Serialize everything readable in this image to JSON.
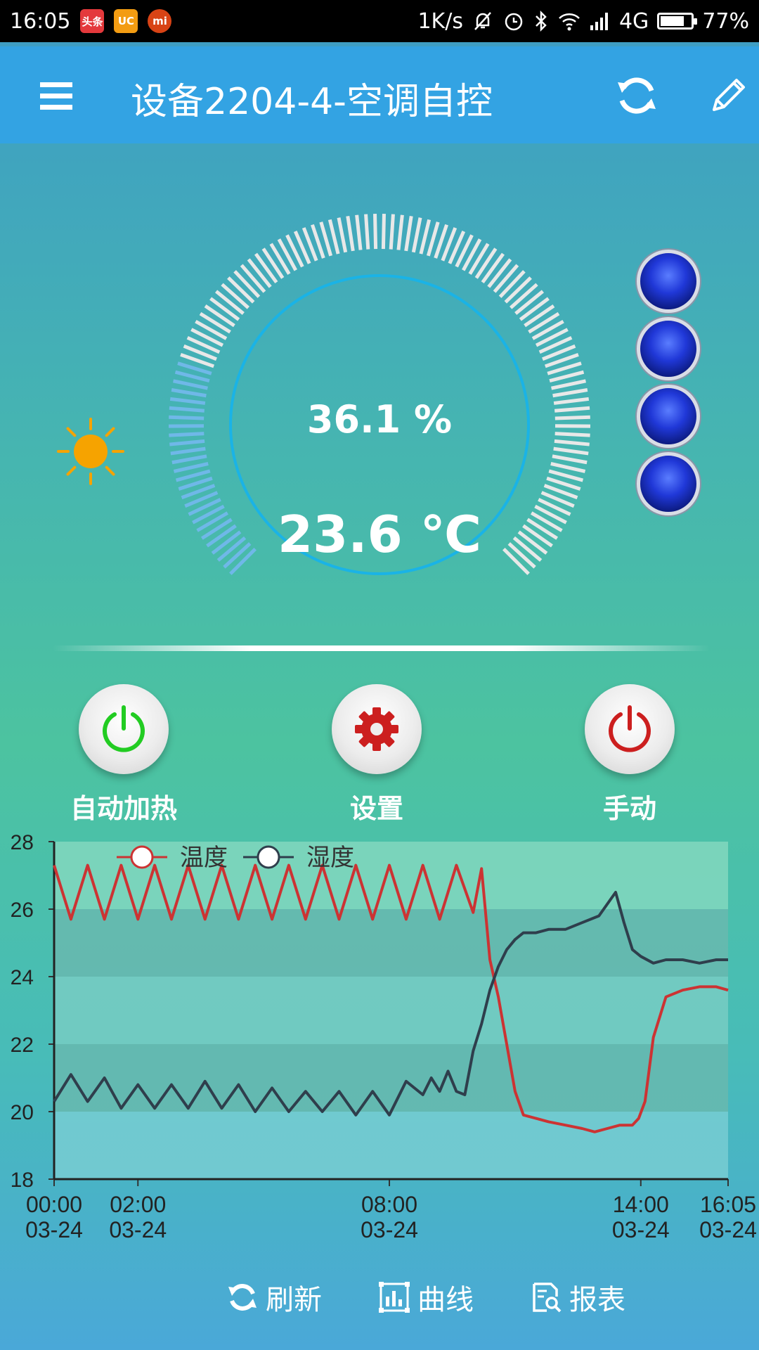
{
  "status_bar": {
    "time": "16:05",
    "net_speed": "1K/s",
    "network": "4G",
    "battery_percent": "77%",
    "battery_level": 0.77,
    "apps": [
      {
        "name": "toutiao",
        "label": "头条",
        "color": "#e4393c"
      },
      {
        "name": "uc",
        "label": "UC",
        "color": "#f39c12"
      },
      {
        "name": "mi",
        "label": "mi",
        "color": "#d84315"
      }
    ]
  },
  "header": {
    "title": "设备2204-4-空调自控",
    "bg_color": "#33a3e3"
  },
  "gauge": {
    "humidity_text": "36.1 %",
    "temperature_text": "23.6 ℃",
    "level": 0.236,
    "sun_color": "#f6a300",
    "active_color": "#6fb8e8",
    "inactive_color": "#e8e8e8",
    "ring_color": "#1ab3e6",
    "leds": 4
  },
  "controls": [
    {
      "label": "自动加热",
      "icon": "power-icon",
      "color": "#22cc22"
    },
    {
      "label": "设置",
      "icon": "gear-icon",
      "color": "#cc1f1f"
    },
    {
      "label": "手动",
      "icon": "power-icon",
      "color": "#cc1f1f"
    }
  ],
  "toolbar": {
    "refresh_label": "刷新",
    "curve_label": "曲线",
    "report_label": "报表"
  },
  "chart_data": {
    "type": "line",
    "ylim": [
      18,
      28
    ],
    "yticks": [
      "18",
      "20",
      "22",
      "24",
      "26",
      "28"
    ],
    "x_ticks": [
      {
        "hour": 0,
        "time": "00:00",
        "date": "03-24"
      },
      {
        "hour": 2,
        "time": "02:00",
        "date": "03-24"
      },
      {
        "hour": 8,
        "time": "08:00",
        "date": "03-24"
      },
      {
        "hour": 14,
        "time": "14:00",
        "date": "03-24"
      },
      {
        "hour": 16.083,
        "time": "16:05",
        "date": "03-24"
      }
    ],
    "xlim": [
      0,
      16.083
    ],
    "series": [
      {
        "name": "温度",
        "color": "#cc3333",
        "x": [
          0,
          0.4,
          0.8,
          1.2,
          1.6,
          2.0,
          2.4,
          2.8,
          3.2,
          3.6,
          4.0,
          4.4,
          4.8,
          5.2,
          5.6,
          6.0,
          6.4,
          6.8,
          7.2,
          7.6,
          8.0,
          8.4,
          8.8,
          9.2,
          9.6,
          10.0,
          10.2,
          10.4,
          10.6,
          10.8,
          11.0,
          11.2,
          11.5,
          11.8,
          12.2,
          12.6,
          12.9,
          13.2,
          13.5,
          13.8,
          13.95,
          14.1,
          14.3,
          14.6,
          15.0,
          15.4,
          15.8,
          16.083
        ],
        "y": [
          27.3,
          25.7,
          27.3,
          25.7,
          27.3,
          25.7,
          27.3,
          25.7,
          27.3,
          25.7,
          27.3,
          25.7,
          27.3,
          25.7,
          27.3,
          25.7,
          27.3,
          25.7,
          27.3,
          25.7,
          27.3,
          25.7,
          27.3,
          25.7,
          27.3,
          25.9,
          27.2,
          24.5,
          23.4,
          22.0,
          20.6,
          19.9,
          19.8,
          19.7,
          19.6,
          19.5,
          19.4,
          19.5,
          19.6,
          19.6,
          19.8,
          20.3,
          22.2,
          23.4,
          23.6,
          23.7,
          23.7,
          23.6
        ]
      },
      {
        "name": "湿度",
        "color": "#2f3e4c",
        "x": [
          0,
          0.4,
          0.8,
          1.2,
          1.6,
          2.0,
          2.4,
          2.8,
          3.2,
          3.6,
          4.0,
          4.4,
          4.8,
          5.2,
          5.6,
          6.0,
          6.4,
          6.8,
          7.2,
          7.6,
          8.0,
          8.4,
          8.8,
          9.0,
          9.2,
          9.4,
          9.6,
          9.8,
          10.0,
          10.2,
          10.4,
          10.6,
          10.8,
          11.0,
          11.2,
          11.5,
          11.8,
          12.2,
          12.6,
          13.0,
          13.4,
          13.6,
          13.8,
          14.0,
          14.3,
          14.6,
          15.0,
          15.4,
          15.8,
          16.083
        ],
        "y": [
          20.3,
          21.1,
          20.3,
          21.0,
          20.1,
          20.8,
          20.1,
          20.8,
          20.1,
          20.9,
          20.1,
          20.8,
          20.0,
          20.7,
          20.0,
          20.6,
          20.0,
          20.6,
          19.9,
          20.6,
          19.9,
          20.9,
          20.5,
          21.0,
          20.6,
          21.2,
          20.6,
          20.5,
          21.8,
          22.6,
          23.6,
          24.3,
          24.8,
          25.1,
          25.3,
          25.3,
          25.4,
          25.4,
          25.6,
          25.8,
          26.5,
          25.6,
          24.8,
          24.6,
          24.4,
          24.5,
          24.5,
          24.4,
          24.5,
          24.5
        ]
      }
    ]
  }
}
